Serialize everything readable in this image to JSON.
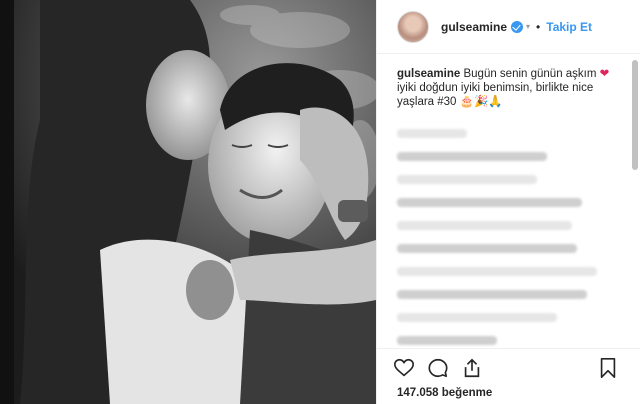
{
  "post": {
    "username": "gulseamine",
    "follow_label": "Takip Et",
    "separator": "•",
    "caption_user": "gulseamine",
    "caption_text": " Bugün senin günün aşkım",
    "caption_heart": "❤",
    "caption_text_2": "iyiki doğdun iyiki benimsin, birlikte nice yaşlara #30",
    "caption_emojis": "🎂🎉🙏",
    "likes": "147.058 beğenme"
  },
  "icons": {
    "like": "heart-outline-icon",
    "comment": "comment-icon",
    "share": "share-icon",
    "save": "bookmark-icon"
  },
  "colors": {
    "accent": "#3897f0",
    "heart": "#e0245e"
  }
}
